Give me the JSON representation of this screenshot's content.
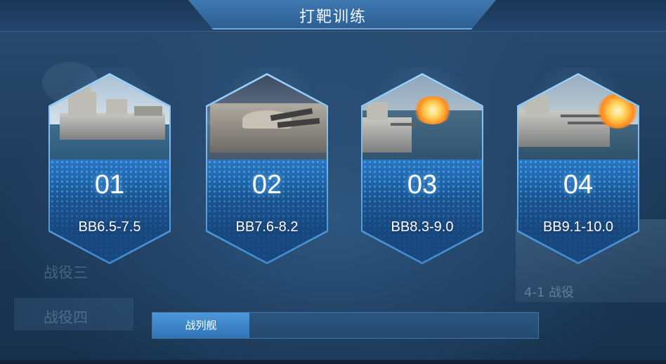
{
  "header": {
    "title": "打靶训练"
  },
  "background": {
    "menu_items": [
      "战役三",
      "战役四"
    ],
    "side_card_label": "4-1 战役"
  },
  "cards": [
    {
      "number": "01",
      "range": "BB6.5-7.5"
    },
    {
      "number": "02",
      "range": "BB7.6-8.2"
    },
    {
      "number": "03",
      "range": "BB8.3-9.0"
    },
    {
      "number": "04",
      "range": "BB9.1-10.0"
    }
  ],
  "tabs": [
    {
      "label": "战列舰",
      "active": true
    }
  ],
  "colors": {
    "accent": "#3f8bd0",
    "tab_active": "#2f74b6",
    "card_border": "#9fd6ff"
  }
}
